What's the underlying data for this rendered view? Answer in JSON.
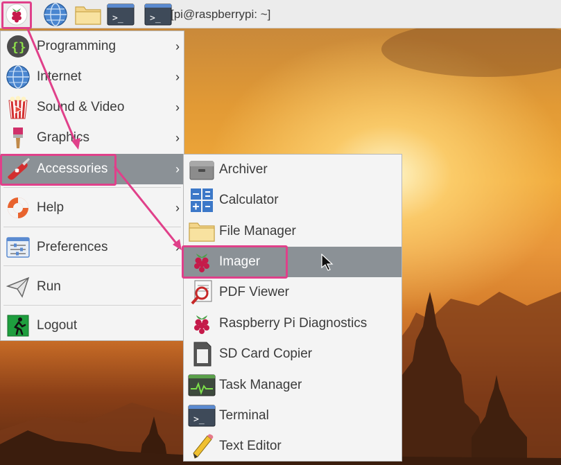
{
  "taskbar": {
    "window_title": "[pi@raspberrypi: ~]",
    "icons": [
      "raspberry-menu-icon",
      "web-browser-icon",
      "file-manager-icon",
      "terminal-icon",
      "terminal-window-icon"
    ]
  },
  "main_menu": {
    "items": [
      {
        "label": "Programming",
        "icon": "programming-icon",
        "has_submenu": true
      },
      {
        "label": "Internet",
        "icon": "globe-icon",
        "has_submenu": true
      },
      {
        "label": "Sound & Video",
        "icon": "popcorn-icon",
        "has_submenu": true
      },
      {
        "label": "Graphics",
        "icon": "paintbrush-icon",
        "has_submenu": true
      },
      {
        "label": "Accessories",
        "icon": "swiss-knife-icon",
        "has_submenu": true,
        "active": true
      },
      {
        "label": "Help",
        "icon": "lifebuoy-icon",
        "has_submenu": true
      },
      {
        "label": "Preferences",
        "icon": "preferences-icon",
        "has_submenu": true
      },
      {
        "label": "Run",
        "icon": "paper-plane-icon",
        "has_submenu": false
      },
      {
        "label": "Logout",
        "icon": "logout-icon",
        "has_submenu": false
      }
    ],
    "arrow_glyph": "›"
  },
  "accessories_menu": {
    "items": [
      {
        "label": "Archiver",
        "icon": "archiver-icon"
      },
      {
        "label": "Calculator",
        "icon": "calculator-icon"
      },
      {
        "label": "File Manager",
        "icon": "folder-icon"
      },
      {
        "label": "Imager",
        "icon": "raspberry-icon",
        "active": true
      },
      {
        "label": "PDF Viewer",
        "icon": "pdf-viewer-icon"
      },
      {
        "label": "Raspberry Pi Diagnostics",
        "icon": "raspberry-icon"
      },
      {
        "label": "SD Card Copier",
        "icon": "sd-card-icon"
      },
      {
        "label": "Task Manager",
        "icon": "task-manager-icon"
      },
      {
        "label": "Terminal",
        "icon": "terminal-icon"
      },
      {
        "label": "Text Editor",
        "icon": "pencil-icon"
      }
    ]
  },
  "colors": {
    "highlight": "#e0408a",
    "active_row": "#8b9196",
    "menu_bg": "#f4f4f4"
  }
}
